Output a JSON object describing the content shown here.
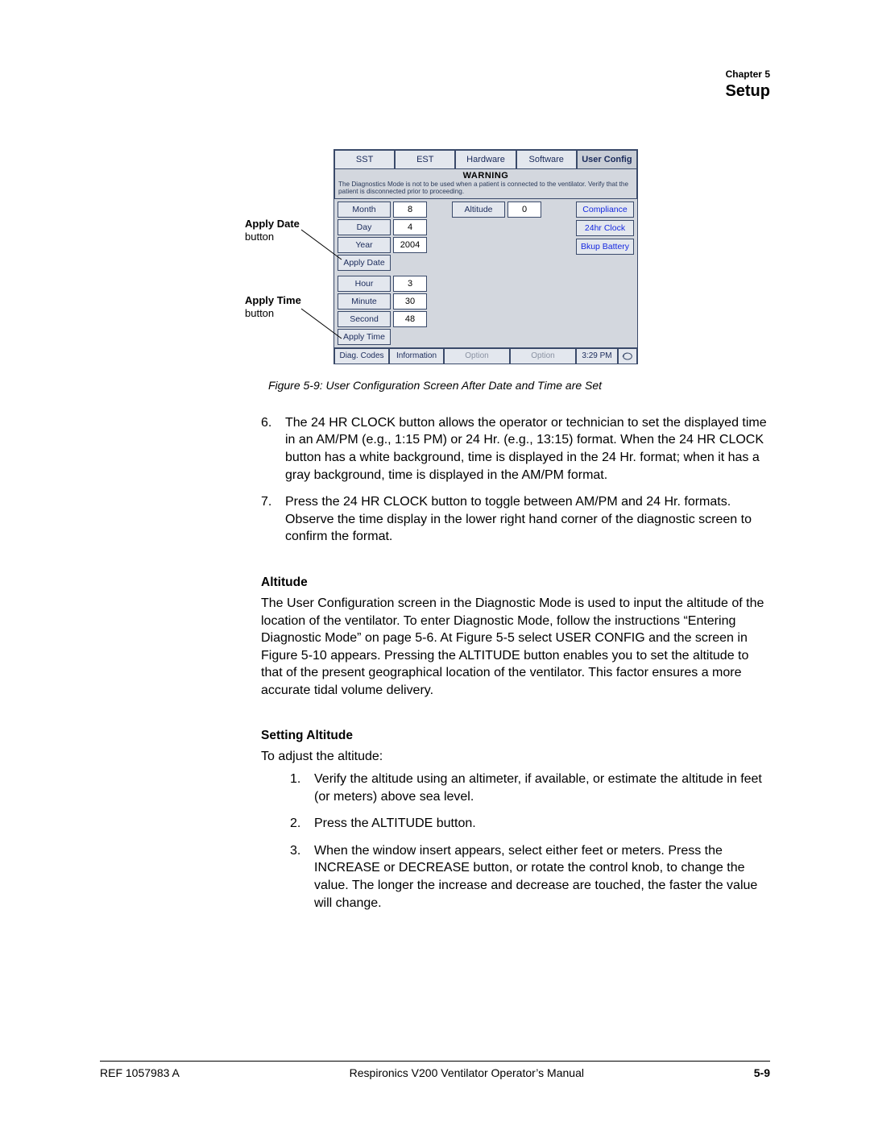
{
  "header": {
    "chapter_label": "Chapter 5",
    "chapter_title": "Setup"
  },
  "callouts": {
    "c1_bold": "Apply Date",
    "c1_plain": "button",
    "c2_bold": "Apply Time",
    "c2_plain": "button"
  },
  "screen": {
    "tabs": [
      "SST",
      "EST",
      "Hardware",
      "Software",
      "User Config"
    ],
    "warning_title": "WARNING",
    "warning_text": "The Diagnostics Mode is not to be used when a patient is connected to the ventilator. Verify that the patient is disconnected prior to proceeding.",
    "date_fields": [
      {
        "label": "Month",
        "value": "8"
      },
      {
        "label": "Day",
        "value": "4"
      },
      {
        "label": "Year",
        "value": "2004"
      }
    ],
    "apply_date": "Apply Date",
    "time_fields": [
      {
        "label": "Hour",
        "value": "3"
      },
      {
        "label": "Minute",
        "value": "30"
      },
      {
        "label": "Second",
        "value": "48"
      }
    ],
    "apply_time": "Apply Time",
    "altitude_label": "Altitude",
    "altitude_value": "0",
    "right_buttons": [
      "Compliance",
      "24hr Clock",
      "Bkup Battery"
    ],
    "bottom": {
      "diag": "Diag. Codes",
      "info": "Information",
      "opt1": "Option",
      "opt2": "Option",
      "time": "3:29 PM"
    }
  },
  "figure_caption": "Figure 5-9: User Configuration Screen After Date and Time are Set",
  "list_a": [
    {
      "num": "6.",
      "text": "The 24 HR CLOCK button allows the operator or technician to set the displayed time in an AM/PM (e.g., 1:15 PM) or 24 Hr. (e.g., 13:15) format. When the 24 HR CLOCK button has a white background, time is displayed in the 24 Hr. format; when it has a gray background, time is displayed in the AM/PM format."
    },
    {
      "num": "7.",
      "text": "Press the 24 HR CLOCK button to toggle between AM/PM and 24 Hr. formats. Observe the time display in the lower right hand corner of the diagnostic screen to confirm the format."
    }
  ],
  "altitude": {
    "heading": "Altitude",
    "para": "The User Configuration screen in the Diagnostic Mode is used to input the altitude of the location of the ventilator. To enter Diagnostic Mode, follow the instructions “Entering Diagnostic Mode” on page 5-6. At Figure 5-5 select USER CONFIG and the screen in Figure 5-10 appears. Pressing the ALTITUDE button enables you to set the altitude to that of the present geographical location of the ventilator. This factor ensures a more accurate tidal volume delivery."
  },
  "setting_altitude": {
    "heading": "Setting Altitude",
    "intro": "To adjust the altitude:",
    "items": [
      {
        "num": "1.",
        "text": "Verify the altitude using an altimeter, if available, or estimate the altitude in feet (or meters) above sea level."
      },
      {
        "num": "2.",
        "text": "Press the ALTITUDE button."
      },
      {
        "num": "3.",
        "text": "When the window insert appears, select either feet or meters. Press the INCREASE or DECREASE button, or rotate the control knob, to change the value. The longer the increase and decrease are touched, the faster the value will change."
      }
    ]
  },
  "footer": {
    "ref": "REF 1057983 A",
    "title": "Respironics V200 Ventilator Operator’s Manual",
    "page": "5-9"
  }
}
